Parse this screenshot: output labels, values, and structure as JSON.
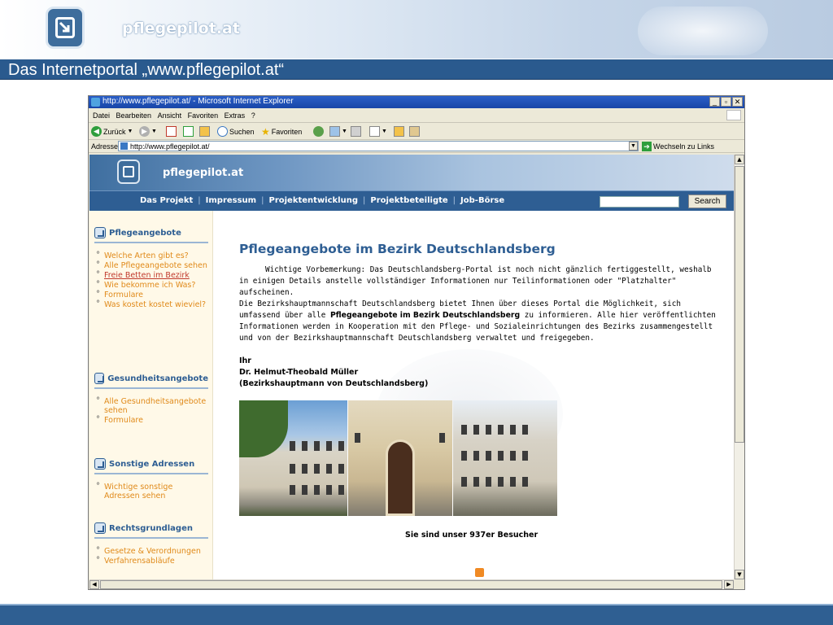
{
  "slide": {
    "brand": "pflegepilot.at",
    "title": "Das Internetportal „www.pflegepilot.at“"
  },
  "browser": {
    "window_title": "http://www.pflegepilot.at/ - Microsoft Internet Explorer",
    "menu": [
      "Datei",
      "Bearbeiten",
      "Ansicht",
      "Favoriten",
      "Extras",
      "?"
    ],
    "toolbar": {
      "back": "Zurück",
      "search": "Suchen",
      "favorites": "Favoriten"
    },
    "address_label": "Adresse",
    "address_value": "http://www.pflegepilot.at/",
    "go_label": "Wechseln zu",
    "links_label": "Links"
  },
  "site": {
    "brand": "pflegepilot.at",
    "nav": [
      "Das Projekt",
      "Impressum",
      "Projektentwicklung",
      "Projektbeteiligte",
      "Job-Börse"
    ],
    "search_button": "Search",
    "sidebar": [
      {
        "heading": "Pflegeangebote",
        "items": [
          "Welche Arten gibt es?",
          "Alle Pflegeangebote sehen",
          "Freie Betten im Bezirk",
          "Wie bekomme ich Was?",
          "Formulare",
          "Was kostet kostet wieviel?"
        ]
      },
      {
        "heading": "Gesundheitsangebote",
        "items": [
          "Alle Gesundheitsangebote sehen",
          "Formulare"
        ]
      },
      {
        "heading": "Sonstige Adressen",
        "items": [
          "Wichtige sonstige Adressen sehen"
        ]
      },
      {
        "heading": "Rechtsgrundlagen",
        "items": [
          "Gesetze & Verordnungen",
          "Verfahrensabläufe"
        ]
      }
    ],
    "main": {
      "heading": "Pflegeangebote im Bezirk Deutschlandsberg",
      "intro": "Wichtige Vorbemerkung: Das Deutschlandsberg-Portal ist noch nicht gänzlich fertiggestellt, weshalb in einigen Details anstelle vollständiger Informationen nur Teilinformationen oder \"Platzhalter\" aufscheinen.",
      "para_before": "Die Bezirkshauptmannschaft Deutschlandsberg bietet Ihnen über dieses Portal die Möglichkeit, sich umfassend über alle ",
      "para_bold": "Pflegeangebote im Bezirk Deutschlandsberg",
      "para_after": " zu informieren. Alle hier veröffentlichten Informationen werden in Kooperation mit den Pflege- und Sozialeinrichtungen des Bezirks zusammengestellt und von der Bezirkshauptmannschaft Deutschlandsberg verwaltet und freigegeben.",
      "sig_1": "Ihr",
      "sig_2": "Dr. Helmut-Theobald Müller",
      "sig_3": "(Bezirkshauptmann von Deutschlandsberg)",
      "visitors": "Sie sind unser 937er Besucher"
    }
  }
}
